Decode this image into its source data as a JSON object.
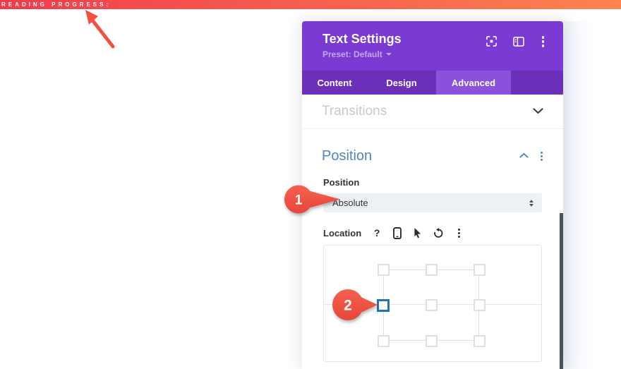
{
  "progress_bar": {
    "label": "READING PROGRESS:",
    "color_start": "#f23b4c",
    "color_end": "#fc8350"
  },
  "modal": {
    "title": "Text Settings",
    "preset_label": "Preset: Default",
    "header_icons": [
      "focus-mode-icon",
      "layout-view-icon",
      "more-options-icon"
    ],
    "tabs": [
      {
        "label": "Content",
        "active": false
      },
      {
        "label": "Design",
        "active": false
      },
      {
        "label": "Advanced",
        "active": true
      }
    ],
    "transitions": {
      "label": "Transitions",
      "state": "collapsed"
    },
    "position_section": {
      "heading": "Position",
      "state": "expanded",
      "field_label": "Position",
      "select_value": "Absolute",
      "location_label": "Location",
      "help_glyph": "?",
      "location_icons": [
        "help-icon",
        "phone-icon",
        "cursor-icon",
        "reset-icon",
        "more-options-icon"
      ],
      "selected_anchor": "middle-left"
    }
  },
  "callouts": [
    {
      "number": "1"
    },
    {
      "number": "2"
    }
  ],
  "colors": {
    "header_purple": "#7b3ad3",
    "tabbar_purple": "#6c2fb8",
    "active_tab_purple": "#8b50dc",
    "section_heading_blue": "#4c87c5",
    "anchor_selected_blue": "#1f73b7",
    "callout_red": "#f25443",
    "scrollbar_dark": "#4a525e"
  }
}
